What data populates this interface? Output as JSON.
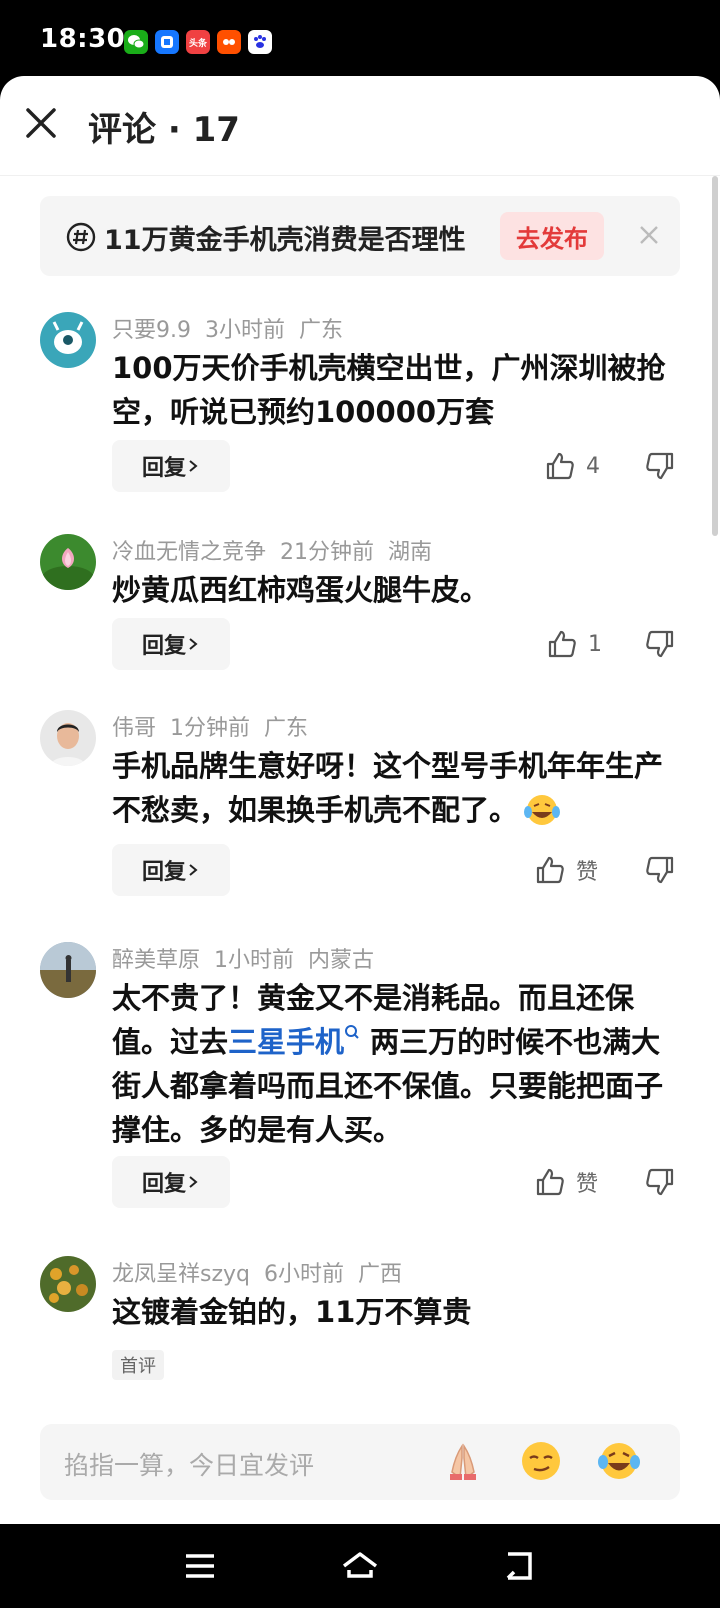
{
  "status_bar": {
    "time": "18:30",
    "app_icons": [
      "wechat-icon",
      "blue-app-icon",
      "toutiao-icon",
      "taobao-icon",
      "baidu-icon"
    ],
    "toutiao_label": "头条"
  },
  "header": {
    "title": "评论 · 17"
  },
  "topic": {
    "text": "11万黄金手机壳消费是否理性",
    "publish_label": "去发布"
  },
  "comments": [
    {
      "user": "只要9.9",
      "time": "3小时前",
      "region": "广东",
      "text": "100万天价手机壳横空出世，广州深圳被抢空，听说已预约100000万套",
      "reply_label": "回复",
      "likes": "4"
    },
    {
      "user": "冷血无情之竞争",
      "time": "21分钟前",
      "region": "湖南",
      "text": "炒黄瓜西红柿鸡蛋火腿牛皮。",
      "reply_label": "回复",
      "likes": "1"
    },
    {
      "user": "伟哥",
      "time": "1分钟前",
      "region": "广东",
      "text": "手机品牌生意好呀！这个型号手机年年生产不愁卖，如果换手机壳不配了。",
      "reply_label": "回复",
      "likes": "赞"
    },
    {
      "user": "醉美草原",
      "time": "1小时前",
      "region": "内蒙古",
      "text_before": "太不贵了！黄金又不是消耗品。而且还保值。过去",
      "link": "三星手机",
      "text_after": " 两三万的时候不也满大街人都拿着吗而且还不保值。只要能把面子撑住。多的是有人买。",
      "reply_label": "回复",
      "likes": "赞"
    },
    {
      "user": "龙凤呈祥szyq",
      "time": "6小时前",
      "region": "广西",
      "text": "这镀着金铂的，11万不算贵",
      "badge": "首评"
    }
  ],
  "input": {
    "placeholder": "掐指一算，今日宜发评"
  },
  "colors": {
    "accent_red": "#e33a3a",
    "link_blue": "#1e63c9"
  }
}
